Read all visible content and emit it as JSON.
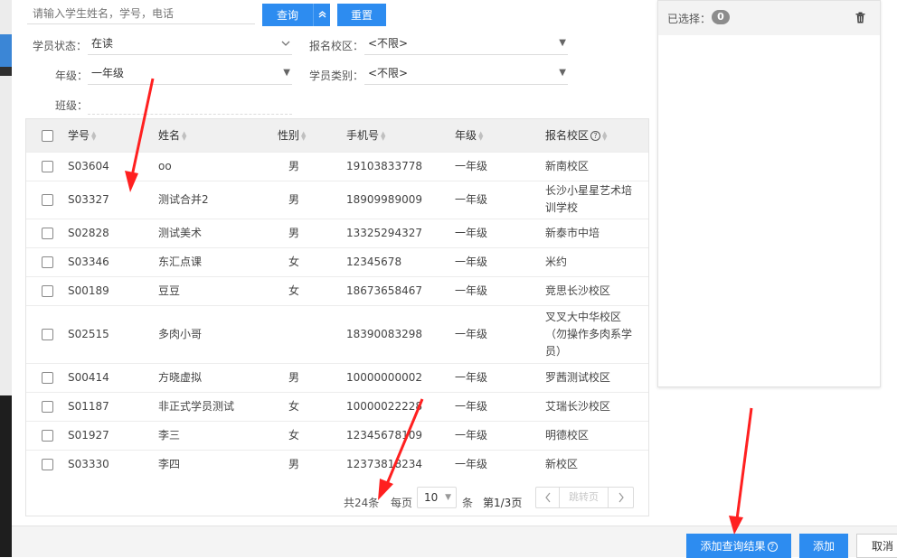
{
  "search": {
    "placeholder": "请输入学生姓名，学号，电话",
    "query_button": "查询",
    "collapse_icon": "double-chevron-up-icon",
    "reset_button": "重置"
  },
  "filters": {
    "status_label": "学员状态：",
    "status_value": "在读",
    "campus_label": "报名校区：",
    "campus_value": "<不限>",
    "grade_label": "年级：",
    "grade_value": "一年级",
    "type_label": "学员类别：",
    "type_value": "<不限>",
    "class_label": "班级："
  },
  "table": {
    "columns": [
      "学号",
      "姓名",
      "性别",
      "手机号",
      "年级",
      "报名校区"
    ],
    "rows": [
      {
        "id": "S03604",
        "name": "oo",
        "gender": "男",
        "phone": "19103833778",
        "grade": "一年级",
        "campus": "新南校区"
      },
      {
        "id": "S03327",
        "name": "测试合并2",
        "gender": "男",
        "phone": "18909989009",
        "grade": "一年级",
        "campus": "长沙小星星艺术培训学校"
      },
      {
        "id": "S02828",
        "name": "测试美术",
        "gender": "男",
        "phone": "13325294327",
        "grade": "一年级",
        "campus": "新泰市中培"
      },
      {
        "id": "S03346",
        "name": "东汇点课",
        "gender": "女",
        "phone": "12345678",
        "grade": "一年级",
        "campus": "米约"
      },
      {
        "id": "S00189",
        "name": "豆豆",
        "gender": "女",
        "phone": "18673658467",
        "grade": "一年级",
        "campus": "竞思长沙校区"
      },
      {
        "id": "S02515",
        "name": "多肉小哥",
        "gender": "",
        "phone": "18390083298",
        "grade": "一年级",
        "campus": "叉叉大中华校区（勿操作多肉系学员）"
      },
      {
        "id": "S00414",
        "name": "方晓虚拟",
        "gender": "男",
        "phone": "10000000002",
        "grade": "一年级",
        "campus": "罗茜测试校区"
      },
      {
        "id": "S01187",
        "name": "非正式学员测试",
        "gender": "女",
        "phone": "10000022228",
        "grade": "一年级",
        "campus": "艾瑞长沙校区"
      },
      {
        "id": "S01927",
        "name": "李三",
        "gender": "女",
        "phone": "12345678109",
        "grade": "一年级",
        "campus": "明德校区"
      },
      {
        "id": "S03330",
        "name": "李四",
        "gender": "男",
        "phone": "12373818234",
        "grade": "一年级",
        "campus": "新校区"
      }
    ]
  },
  "pagination": {
    "total": "共24条",
    "per_page_label": "每页",
    "page_size": "10",
    "unit": "条",
    "page_info": "第1/3页",
    "jump_placeholder": "跳转页"
  },
  "selected_panel": {
    "label": "已选择：",
    "count": "0",
    "clear_icon": "trash-icon"
  },
  "footer": {
    "add_results_button": "添加查询结果",
    "add_button": "添加",
    "cancel_button": "取消"
  },
  "colors": {
    "primary": "#2d8cf0",
    "annotation_arrow": "#ff2020"
  }
}
